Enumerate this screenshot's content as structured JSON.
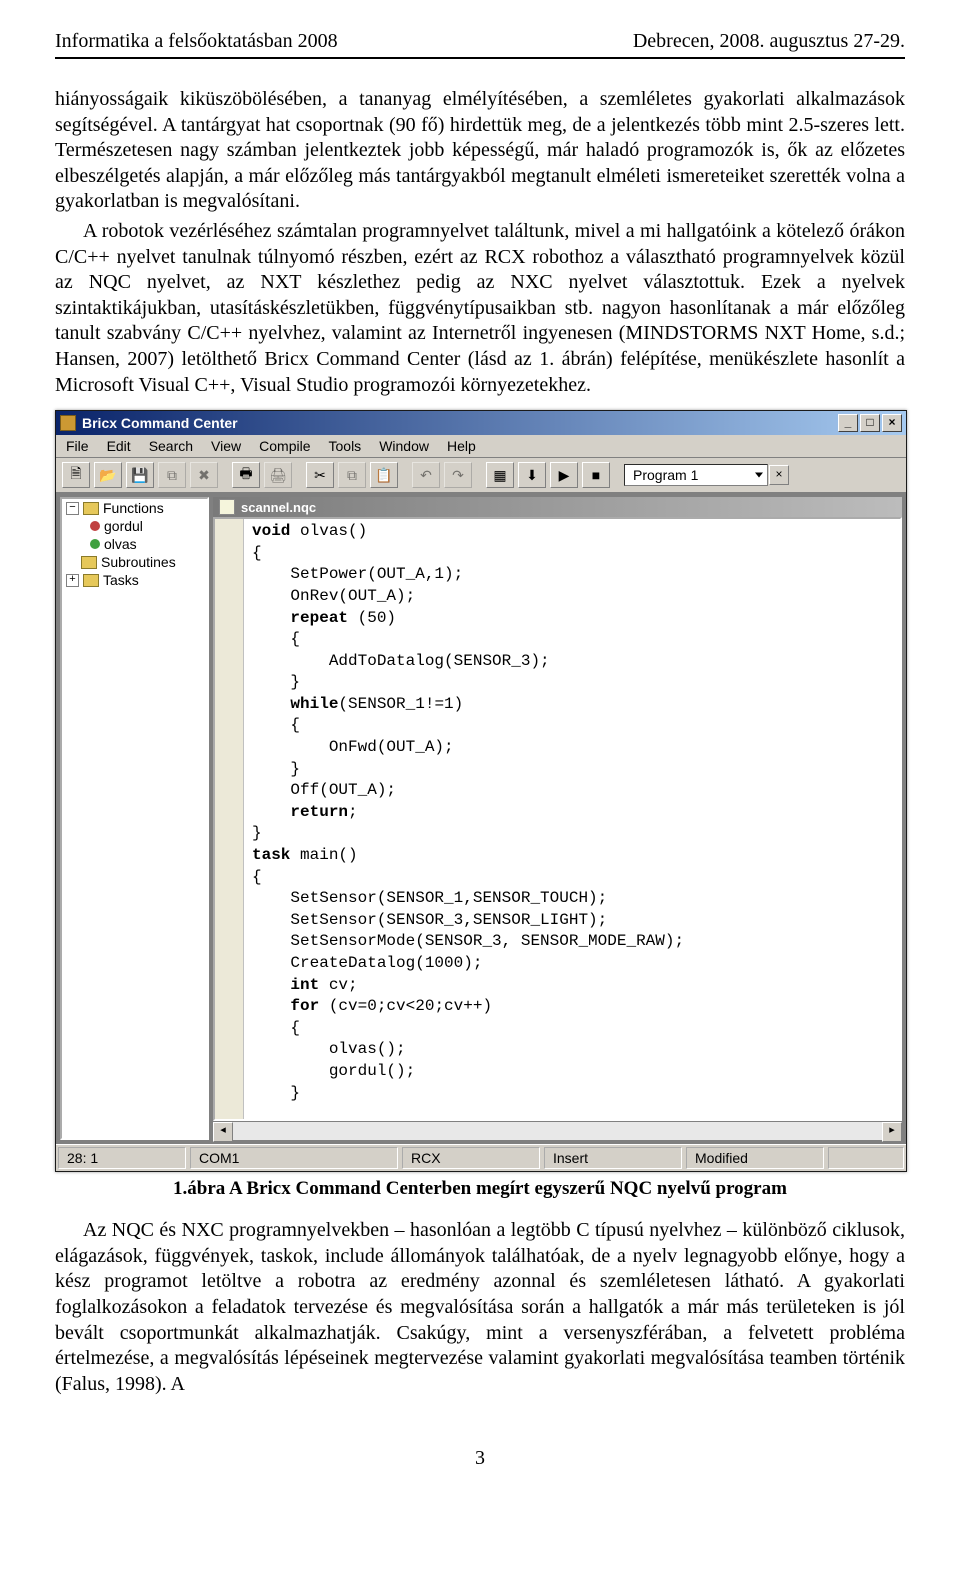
{
  "header": {
    "left": "Informatika a felsőoktatásban 2008",
    "right": "Debrecen, 2008. augusztus 27-29."
  },
  "paragraphs": {
    "p1": "hiányosságaik kiküszöbölésében, a tananyag elmélyítésében, a szemléletes gyakorlati alkalmazások segítségével. A tantárgyat hat csoportnak (90 fő) hirdettük meg, de a jelentkezés több mint 2.5-szeres lett. Természetesen nagy számban jelentkeztek jobb képességű, már haladó programozók is, ők az előzetes elbeszélgetés alapján, a már előzőleg más tantárgyakból megtanult elméleti ismereteiket szerették volna a gyakorlatban is megvalósítani.",
    "p2": "A robotok vezérléséhez számtalan programnyelvet találtunk, mivel a mi hallgatóink a kötelező órákon C/C++ nyelvet tanulnak túlnyomó részben, ezért  az RCX robothoz a választható programnyelvek közül az NQC nyelvet, az NXT készlethez pedig az NXC nyelvet választottuk. Ezek a nyelvek szintaktikájukban, utasításkészletükben, függvénytípusaikban stb. nagyon hasonlítanak a már előzőleg tanult szabvány C/C++ nyelvhez, valamint az Internetről ingyenesen (MINDSTORMS NXT Home, s.d.; Hansen, 2007) letölthető Bricx Command Center (lásd az 1. ábrán) felépítése, menükészlete hasonlít a Microsoft Visual C++, Visual Studio programozói környezetekhez.",
    "p3": "Az NQC és NXC programnyelvekben – hasonlóan a legtöbb C típusú nyelvhez – különböző ciklusok, elágazások, függvények, taskok, include állományok találhatóak, de a nyelv legnagyobb előnye, hogy a kész programot letöltve a robotra az eredmény azonnal és szemléletesen látható. A gyakorlati foglalkozásokon a feladatok tervezése és megvalósítása során a hallgatók a már más területeken is jól bevált csoportmunkát alkalmazhatják. Csakúgy, mint a versenyszférában, a felvetett probléma értelmezése, a megvalósítás lépéseinek megtervezése valamint gyakorlati megvalósítása teamben történik (Falus, 1998). A"
  },
  "caption": "1.ábra A Bricx Command Centerben megírt egyszerű NQC nyelvű program",
  "page_number": "3",
  "app": {
    "title": "Bricx Command Center",
    "menus": [
      "File",
      "Edit",
      "Search",
      "View",
      "Compile",
      "Tools",
      "Window",
      "Help"
    ],
    "tabname": "Program 1",
    "tree": {
      "root": "Functions",
      "items": [
        "gordul",
        "olvas"
      ],
      "subroutines": "Subroutines",
      "tasks": "Tasks"
    },
    "editor_file": "scannel.nqc",
    "code_plain": "void olvas()\n{\n    SetPower(OUT_A,1);\n    OnRev(OUT_A);\n    repeat (50)\n    {\n        AddToDatalog(SENSOR_3);\n    }\n    while(SENSOR_1!=1)\n    {\n        OnFwd(OUT_A);\n    }\n    Off(OUT_A);\n    return;\n}\ntask main()\n{\n    SetSensor(SENSOR_1,SENSOR_TOUCH);\n    SetSensor(SENSOR_3,SENSOR_LIGHT);\n    SetSensorMode(SENSOR_3, SENSOR_MODE_RAW);\n    CreateDatalog(1000);\n    int cv;\n    for (cv=0;cv<20;cv++)\n    {\n        olvas();\n        gordul();\n    }",
    "status": {
      "pos": "28: 1",
      "port": "COM1",
      "target": "RCX",
      "mode": "Insert",
      "state": "Modified"
    }
  }
}
